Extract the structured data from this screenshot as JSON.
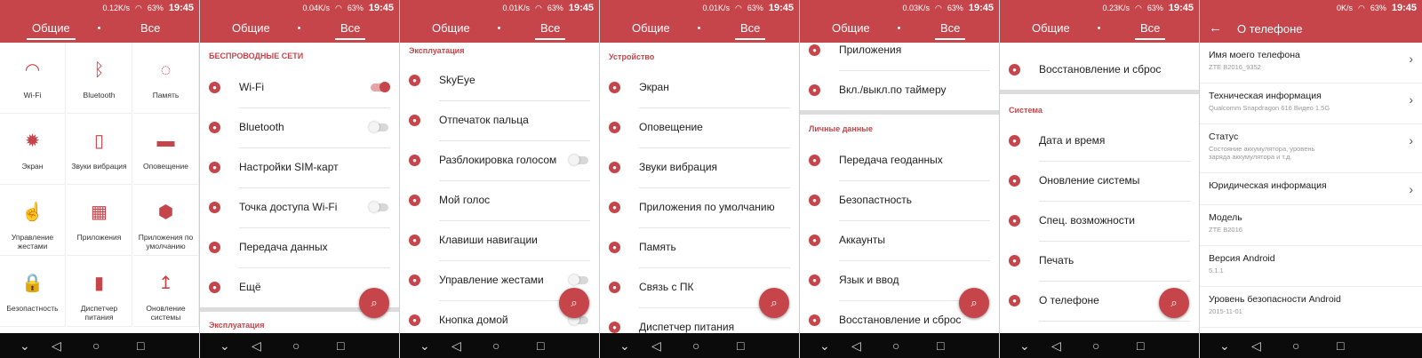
{
  "status": [
    {
      "speed": "0.12K/s",
      "battery": "63%",
      "time": "19:45"
    },
    {
      "speed": "0.04K/s",
      "battery": "63%",
      "time": "19:45"
    },
    {
      "speed": "0.01K/s",
      "battery": "63%",
      "time": "19:45"
    },
    {
      "speed": "0.01K/s",
      "battery": "63%",
      "time": "19:45"
    },
    {
      "speed": "0.03K/s",
      "battery": "63%",
      "time": "19:45"
    },
    {
      "speed": "0.23K/s",
      "battery": "63%",
      "time": "19:45"
    },
    {
      "speed": "0K/s",
      "battery": "63%",
      "time": "19:45"
    }
  ],
  "tabs": {
    "general": "Общие",
    "all": "Все"
  },
  "grid": [
    {
      "label": "Wi-Fi",
      "icon": "wifi-icon",
      "glyph": "◠"
    },
    {
      "label": "Bluetooth",
      "icon": "bluetooth-icon",
      "glyph": "ᛒ"
    },
    {
      "label": "Память",
      "icon": "storage-icon",
      "glyph": "◌"
    },
    {
      "label": "Экран",
      "icon": "display-icon",
      "glyph": "✹"
    },
    {
      "label": "Звуки вибрация",
      "icon": "vibration-icon",
      "glyph": "▯"
    },
    {
      "label": "Оповещение",
      "icon": "notification-icon",
      "glyph": "▬"
    },
    {
      "label": "Управление жестами",
      "icon": "gesture-icon",
      "glyph": "☝"
    },
    {
      "label": "Приложения",
      "icon": "apps-icon",
      "glyph": "▦"
    },
    {
      "label": "Приложения по умолчанию",
      "icon": "default-apps-icon",
      "glyph": "⬢"
    },
    {
      "label": "Безопастность",
      "icon": "lock-icon",
      "glyph": "🔒"
    },
    {
      "label": "Диспетчер питания",
      "icon": "battery-icon",
      "glyph": "▮"
    },
    {
      "label": "Оновление системы",
      "icon": "update-icon",
      "glyph": "↥"
    }
  ],
  "p2": {
    "section": "БЕСПРОВОДНЫЕ СЕТИ",
    "items": [
      "Wi-Fi",
      "Bluetooth",
      "Настройки SIM-карт",
      "Точка доступа Wi-Fi",
      "Передача данных",
      "Ещё"
    ],
    "next_section": "Эксплуатация"
  },
  "p3": {
    "section": "Эксплуатация",
    "items": [
      "SkyEye",
      "Отпечаток пальца",
      "Разблокировка голосом",
      "Мой голос",
      "Клавиши навигации",
      "Управление жестами",
      "Кнопка домой"
    ]
  },
  "p4": {
    "section": "Устройство",
    "items": [
      "Экран",
      "Оповещение",
      "Звуки вибрация",
      "Приложения по умолчанию",
      "Память",
      "Связь с ПК",
      "Диспетчер питания"
    ]
  },
  "p5": {
    "top_items": [
      "Приложения",
      "Вкл./выкл.по таймеру"
    ],
    "section": "Личные данные",
    "items": [
      "Передача геоданных",
      "Безопастность",
      "Аккаунты",
      "Язык и ввод",
      "Восстановление и сброс"
    ]
  },
  "p6": {
    "top_item": "Восстановление и сброс",
    "section": "Система",
    "items": [
      "Дата и время",
      "Оновление системы",
      "Спец. возможности",
      "Печать",
      "О телефоне"
    ]
  },
  "about": {
    "title": "О телефоне",
    "items": [
      {
        "title": "Имя моего телефона",
        "sub": "ZTE B2016_9352",
        "chev": "›"
      },
      {
        "title": "Техническая информация",
        "sub": "Qualcomm Snapdragon 616  Видео 1.5G",
        "chev": "›"
      },
      {
        "title": "Статус",
        "sub": "Состояние аккумулятора, уровень заряда аккумулятора и т.д.",
        "chev": "›"
      },
      {
        "title": "Юридическая информация",
        "sub": "",
        "chev": "›"
      },
      {
        "title": "Модель",
        "sub": "ZTE B2016",
        "chev": ""
      },
      {
        "title": "Версия Android",
        "sub": "5.1.1",
        "chev": ""
      },
      {
        "title": "Уровень безопасности Android",
        "sub": "2015-11-01",
        "chev": ""
      }
    ]
  },
  "colors": {
    "accent": "#c6454a",
    "nav": "#0b0b0b"
  }
}
